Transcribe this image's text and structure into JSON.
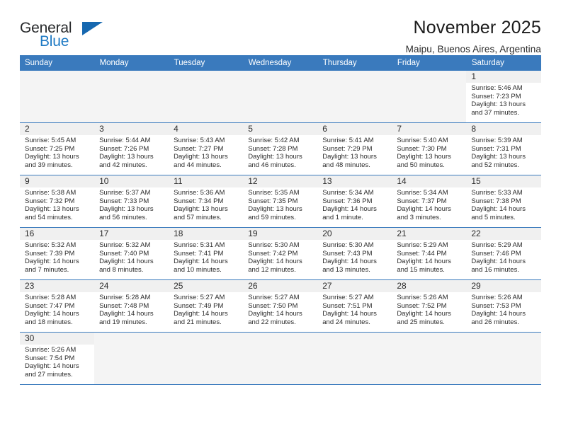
{
  "brand": {
    "name_top": "General",
    "name_bottom": "Blue",
    "triangle_icon": "blue-triangle-icon",
    "accent_color": "#1668b0"
  },
  "header": {
    "title": "November 2025",
    "subtitle": "Maipu, Buenos Aires, Argentina"
  },
  "calendar": {
    "header_bg": "#3a7abd",
    "daynum_bg": "#f0f0f0",
    "weekday_headers": [
      "Sunday",
      "Monday",
      "Tuesday",
      "Wednesday",
      "Thursday",
      "Friday",
      "Saturday"
    ],
    "weeks": [
      [
        {
          "day": "",
          "sunrise": "",
          "sunset": "",
          "daylight": ""
        },
        {
          "day": "",
          "sunrise": "",
          "sunset": "",
          "daylight": ""
        },
        {
          "day": "",
          "sunrise": "",
          "sunset": "",
          "daylight": ""
        },
        {
          "day": "",
          "sunrise": "",
          "sunset": "",
          "daylight": ""
        },
        {
          "day": "",
          "sunrise": "",
          "sunset": "",
          "daylight": ""
        },
        {
          "day": "",
          "sunrise": "",
          "sunset": "",
          "daylight": ""
        },
        {
          "day": "1",
          "sunrise": "Sunrise: 5:46 AM",
          "sunset": "Sunset: 7:23 PM",
          "daylight": "Daylight: 13 hours and 37 minutes."
        }
      ],
      [
        {
          "day": "2",
          "sunrise": "Sunrise: 5:45 AM",
          "sunset": "Sunset: 7:25 PM",
          "daylight": "Daylight: 13 hours and 39 minutes."
        },
        {
          "day": "3",
          "sunrise": "Sunrise: 5:44 AM",
          "sunset": "Sunset: 7:26 PM",
          "daylight": "Daylight: 13 hours and 42 minutes."
        },
        {
          "day": "4",
          "sunrise": "Sunrise: 5:43 AM",
          "sunset": "Sunset: 7:27 PM",
          "daylight": "Daylight: 13 hours and 44 minutes."
        },
        {
          "day": "5",
          "sunrise": "Sunrise: 5:42 AM",
          "sunset": "Sunset: 7:28 PM",
          "daylight": "Daylight: 13 hours and 46 minutes."
        },
        {
          "day": "6",
          "sunrise": "Sunrise: 5:41 AM",
          "sunset": "Sunset: 7:29 PM",
          "daylight": "Daylight: 13 hours and 48 minutes."
        },
        {
          "day": "7",
          "sunrise": "Sunrise: 5:40 AM",
          "sunset": "Sunset: 7:30 PM",
          "daylight": "Daylight: 13 hours and 50 minutes."
        },
        {
          "day": "8",
          "sunrise": "Sunrise: 5:39 AM",
          "sunset": "Sunset: 7:31 PM",
          "daylight": "Daylight: 13 hours and 52 minutes."
        }
      ],
      [
        {
          "day": "9",
          "sunrise": "Sunrise: 5:38 AM",
          "sunset": "Sunset: 7:32 PM",
          "daylight": "Daylight: 13 hours and 54 minutes."
        },
        {
          "day": "10",
          "sunrise": "Sunrise: 5:37 AM",
          "sunset": "Sunset: 7:33 PM",
          "daylight": "Daylight: 13 hours and 56 minutes."
        },
        {
          "day": "11",
          "sunrise": "Sunrise: 5:36 AM",
          "sunset": "Sunset: 7:34 PM",
          "daylight": "Daylight: 13 hours and 57 minutes."
        },
        {
          "day": "12",
          "sunrise": "Sunrise: 5:35 AM",
          "sunset": "Sunset: 7:35 PM",
          "daylight": "Daylight: 13 hours and 59 minutes."
        },
        {
          "day": "13",
          "sunrise": "Sunrise: 5:34 AM",
          "sunset": "Sunset: 7:36 PM",
          "daylight": "Daylight: 14 hours and 1 minute."
        },
        {
          "day": "14",
          "sunrise": "Sunrise: 5:34 AM",
          "sunset": "Sunset: 7:37 PM",
          "daylight": "Daylight: 14 hours and 3 minutes."
        },
        {
          "day": "15",
          "sunrise": "Sunrise: 5:33 AM",
          "sunset": "Sunset: 7:38 PM",
          "daylight": "Daylight: 14 hours and 5 minutes."
        }
      ],
      [
        {
          "day": "16",
          "sunrise": "Sunrise: 5:32 AM",
          "sunset": "Sunset: 7:39 PM",
          "daylight": "Daylight: 14 hours and 7 minutes."
        },
        {
          "day": "17",
          "sunrise": "Sunrise: 5:32 AM",
          "sunset": "Sunset: 7:40 PM",
          "daylight": "Daylight: 14 hours and 8 minutes."
        },
        {
          "day": "18",
          "sunrise": "Sunrise: 5:31 AM",
          "sunset": "Sunset: 7:41 PM",
          "daylight": "Daylight: 14 hours and 10 minutes."
        },
        {
          "day": "19",
          "sunrise": "Sunrise: 5:30 AM",
          "sunset": "Sunset: 7:42 PM",
          "daylight": "Daylight: 14 hours and 12 minutes."
        },
        {
          "day": "20",
          "sunrise": "Sunrise: 5:30 AM",
          "sunset": "Sunset: 7:43 PM",
          "daylight": "Daylight: 14 hours and 13 minutes."
        },
        {
          "day": "21",
          "sunrise": "Sunrise: 5:29 AM",
          "sunset": "Sunset: 7:44 PM",
          "daylight": "Daylight: 14 hours and 15 minutes."
        },
        {
          "day": "22",
          "sunrise": "Sunrise: 5:29 AM",
          "sunset": "Sunset: 7:46 PM",
          "daylight": "Daylight: 14 hours and 16 minutes."
        }
      ],
      [
        {
          "day": "23",
          "sunrise": "Sunrise: 5:28 AM",
          "sunset": "Sunset: 7:47 PM",
          "daylight": "Daylight: 14 hours and 18 minutes."
        },
        {
          "day": "24",
          "sunrise": "Sunrise: 5:28 AM",
          "sunset": "Sunset: 7:48 PM",
          "daylight": "Daylight: 14 hours and 19 minutes."
        },
        {
          "day": "25",
          "sunrise": "Sunrise: 5:27 AM",
          "sunset": "Sunset: 7:49 PM",
          "daylight": "Daylight: 14 hours and 21 minutes."
        },
        {
          "day": "26",
          "sunrise": "Sunrise: 5:27 AM",
          "sunset": "Sunset: 7:50 PM",
          "daylight": "Daylight: 14 hours and 22 minutes."
        },
        {
          "day": "27",
          "sunrise": "Sunrise: 5:27 AM",
          "sunset": "Sunset: 7:51 PM",
          "daylight": "Daylight: 14 hours and 24 minutes."
        },
        {
          "day": "28",
          "sunrise": "Sunrise: 5:26 AM",
          "sunset": "Sunset: 7:52 PM",
          "daylight": "Daylight: 14 hours and 25 minutes."
        },
        {
          "day": "29",
          "sunrise": "Sunrise: 5:26 AM",
          "sunset": "Sunset: 7:53 PM",
          "daylight": "Daylight: 14 hours and 26 minutes."
        }
      ],
      [
        {
          "day": "30",
          "sunrise": "Sunrise: 5:26 AM",
          "sunset": "Sunset: 7:54 PM",
          "daylight": "Daylight: 14 hours and 27 minutes."
        },
        {
          "day": "",
          "sunrise": "",
          "sunset": "",
          "daylight": ""
        },
        {
          "day": "",
          "sunrise": "",
          "sunset": "",
          "daylight": ""
        },
        {
          "day": "",
          "sunrise": "",
          "sunset": "",
          "daylight": ""
        },
        {
          "day": "",
          "sunrise": "",
          "sunset": "",
          "daylight": ""
        },
        {
          "day": "",
          "sunrise": "",
          "sunset": "",
          "daylight": ""
        },
        {
          "day": "",
          "sunrise": "",
          "sunset": "",
          "daylight": ""
        }
      ]
    ]
  }
}
